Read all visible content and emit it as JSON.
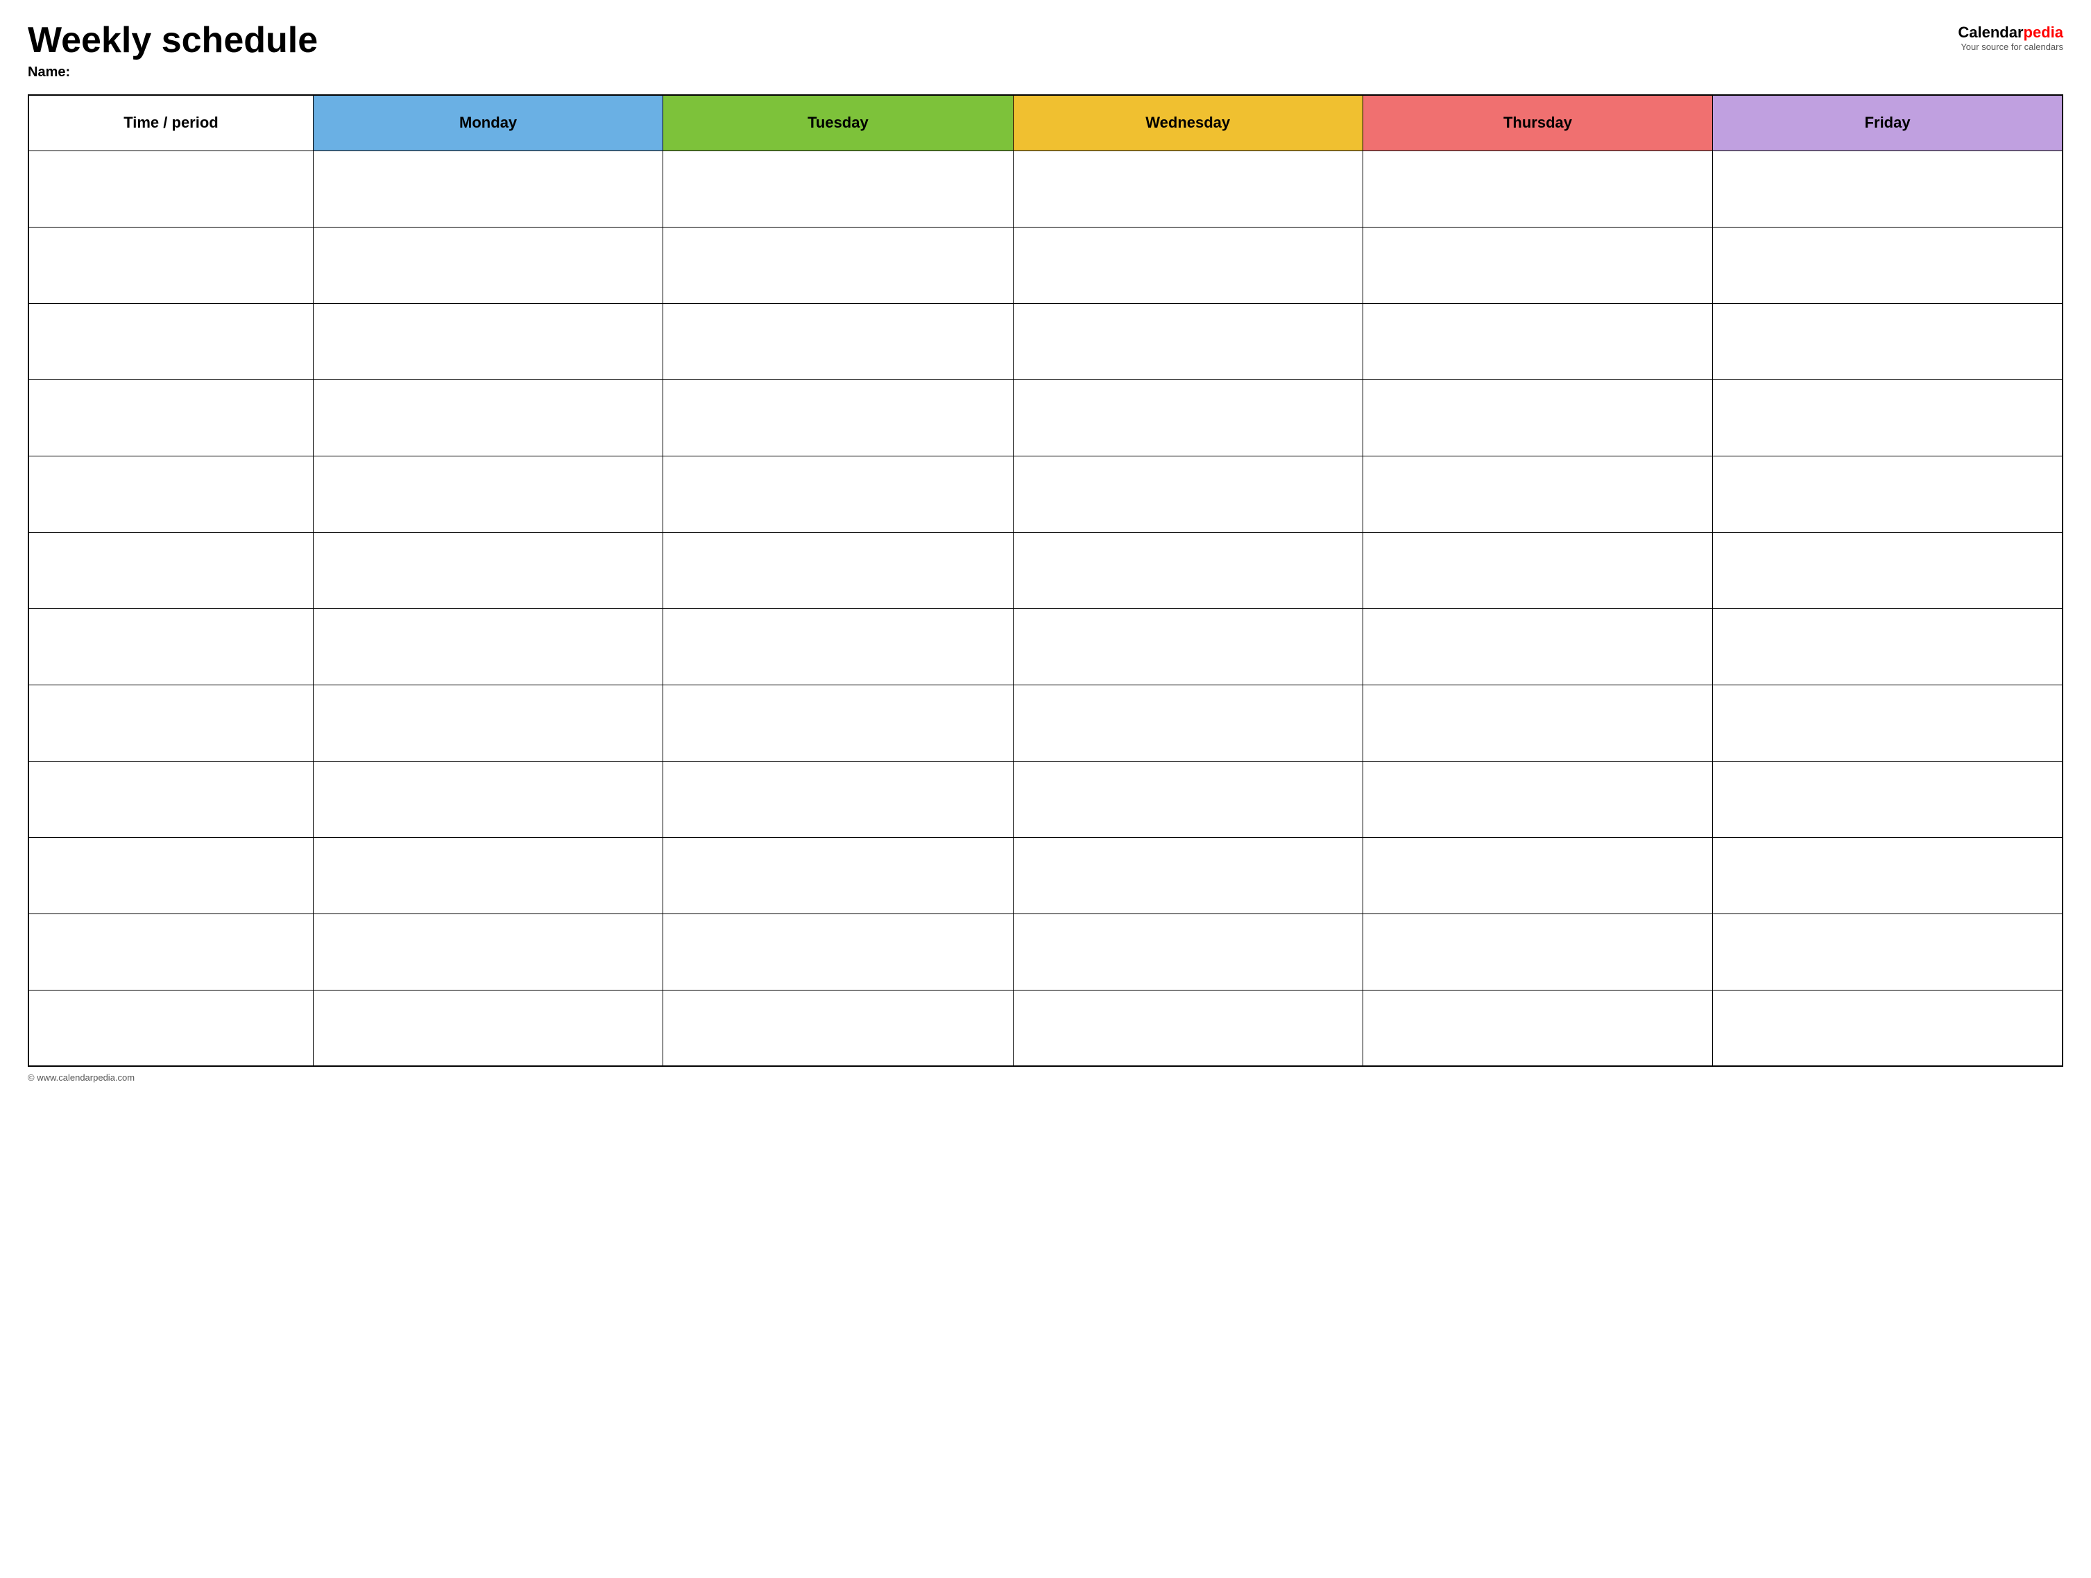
{
  "header": {
    "title": "Weekly schedule",
    "name_label": "Name:",
    "logo_calendar": "Calendar",
    "logo_pedia": "pedia",
    "logo_tagline": "Your source for calendars"
  },
  "table": {
    "columns": [
      {
        "key": "time",
        "label": "Time / period",
        "color_class": "col-time"
      },
      {
        "key": "monday",
        "label": "Monday",
        "color_class": "col-monday"
      },
      {
        "key": "tuesday",
        "label": "Tuesday",
        "color_class": "col-tuesday"
      },
      {
        "key": "wednesday",
        "label": "Wednesday",
        "color_class": "col-wednesday"
      },
      {
        "key": "thursday",
        "label": "Thursday",
        "color_class": "col-thursday"
      },
      {
        "key": "friday",
        "label": "Friday",
        "color_class": "col-friday"
      }
    ],
    "row_count": 12
  },
  "footer": {
    "url": "© www.calendarpedia.com"
  }
}
